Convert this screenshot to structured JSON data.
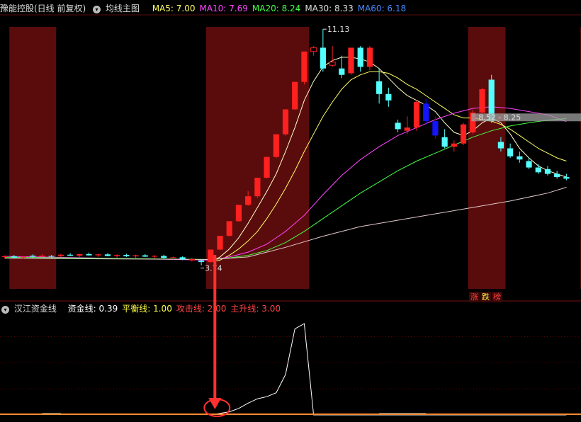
{
  "header": {
    "stock_title": "豫能控股(日线 前复权)",
    "indicator_name": "均线主图",
    "ma_labels": [
      {
        "text": "MA5: 7.00",
        "color": "#ffff66"
      },
      {
        "text": "MA10: 7.69",
        "color": "#ff44ff"
      },
      {
        "text": "MA20: 8.24",
        "color": "#44ff44"
      },
      {
        "text": "MA30: 8.33",
        "color": "#dddddd"
      },
      {
        "text": "MA60: 6.18",
        "color": "#4488ff"
      }
    ]
  },
  "sub_header": {
    "name": "汉江资金线",
    "labels": [
      {
        "text": "资金线: 0.39",
        "color": "#ffffff"
      },
      {
        "text": "平衡线: 1.00",
        "color": "#ffff44"
      },
      {
        "text": "攻击线: 2.00",
        "color": "#ff4444"
      },
      {
        "text": "主升线: 3.00",
        "color": "#ff4444"
      }
    ]
  },
  "colors": {
    "background": "#000000",
    "zone": "#5a0c0c",
    "up": "#ff2020",
    "down_cyan": "#54ffff",
    "down_blue": "#1414ff",
    "grid": "#5a0000",
    "arrow": "#ff3030"
  },
  "chart_data": [
    {
      "type": "candlestick",
      "ylim": [
        3.0,
        11.6
      ],
      "price_annotations": [
        {
          "text": "11.13",
          "value": 11.13
        },
        {
          "text": "3.74",
          "value": 3.74
        },
        {
          "text": "8.52 - 8.25",
          "value": 8.38
        }
      ],
      "highlight_zones": [
        [
          1,
          5
        ],
        [
          22,
          32
        ],
        [
          50,
          53
        ],
        [
          62,
          63
        ]
      ],
      "candles": [
        [
          4.0,
          4.05,
          3.95,
          4.02
        ],
        [
          4.02,
          4.06,
          3.96,
          3.98
        ],
        [
          3.98,
          4.03,
          3.94,
          4.01
        ],
        [
          4.01,
          4.08,
          3.97,
          4.04
        ],
        [
          4.04,
          4.09,
          4.0,
          4.01
        ],
        [
          4.01,
          4.06,
          3.96,
          4.03
        ],
        [
          4.03,
          4.1,
          3.99,
          4.07
        ],
        [
          4.07,
          4.12,
          4.02,
          4.04
        ],
        [
          4.04,
          4.1,
          4.0,
          4.09
        ],
        [
          4.09,
          4.14,
          4.04,
          4.05
        ],
        [
          4.05,
          4.1,
          4.0,
          4.08
        ],
        [
          4.08,
          4.12,
          4.02,
          4.03
        ],
        [
          4.03,
          4.08,
          3.98,
          4.06
        ],
        [
          4.06,
          4.1,
          4.0,
          4.02
        ],
        [
          4.02,
          4.07,
          3.97,
          4.05
        ],
        [
          4.05,
          4.09,
          4.0,
          4.01
        ],
        [
          4.01,
          4.06,
          3.96,
          4.03
        ],
        [
          4.03,
          4.07,
          3.95,
          3.97
        ],
        [
          3.97,
          4.01,
          3.92,
          3.99
        ],
        [
          3.99,
          4.02,
          3.9,
          3.93
        ],
        [
          3.93,
          3.97,
          3.86,
          3.89
        ],
        [
          3.89,
          3.92,
          3.74,
          3.84
        ],
        [
          3.84,
          4.23,
          3.82,
          4.23
        ],
        [
          4.23,
          4.66,
          4.22,
          4.66
        ],
        [
          4.66,
          5.12,
          4.64,
          5.12
        ],
        [
          5.12,
          5.63,
          5.1,
          5.63
        ],
        [
          5.63,
          6.06,
          5.6,
          5.9
        ],
        [
          5.9,
          6.48,
          5.85,
          6.48
        ],
        [
          6.48,
          7.13,
          6.46,
          7.13
        ],
        [
          7.13,
          7.84,
          7.1,
          7.84
        ],
        [
          7.84,
          8.62,
          7.8,
          8.62
        ],
        [
          8.62,
          9.48,
          8.6,
          9.48
        ],
        [
          9.48,
          10.43,
          9.4,
          10.43
        ],
        [
          10.43,
          10.6,
          10.3,
          10.55
        ],
        [
          10.55,
          11.13,
          9.8,
          9.9
        ],
        [
          10.0,
          10.6,
          9.95,
          10.1
        ],
        [
          9.9,
          10.3,
          9.6,
          9.7
        ],
        [
          9.75,
          10.55,
          9.7,
          10.55
        ],
        [
          10.55,
          10.6,
          9.8,
          9.95
        ],
        [
          9.95,
          10.6,
          9.85,
          10.55
        ],
        [
          9.5,
          9.9,
          8.8,
          9.1
        ],
        [
          9.1,
          9.3,
          8.7,
          8.9
        ],
        [
          8.2,
          8.3,
          7.9,
          8.0
        ],
        [
          7.95,
          8.4,
          7.85,
          8.05
        ],
        [
          8.05,
          8.9,
          7.95,
          8.85
        ],
        [
          8.8,
          8.95,
          8.15,
          8.25
        ],
        [
          8.25,
          8.4,
          7.7,
          7.8
        ],
        [
          7.75,
          8.0,
          7.4,
          7.45
        ],
        [
          7.45,
          7.65,
          7.3,
          7.55
        ],
        [
          7.55,
          8.2,
          7.5,
          8.15
        ],
        [
          7.9,
          8.6,
          7.85,
          8.52
        ],
        [
          8.52,
          9.3,
          8.5,
          9.25
        ],
        [
          9.55,
          9.7,
          8.2,
          8.25
        ],
        [
          7.6,
          7.75,
          7.3,
          7.4
        ],
        [
          7.4,
          7.55,
          7.1,
          7.15
        ],
        [
          7.15,
          7.3,
          6.95,
          7.05
        ],
        [
          7.0,
          7.1,
          6.75,
          6.8
        ],
        [
          6.8,
          6.9,
          6.6,
          6.65
        ],
        [
          6.75,
          6.85,
          6.55,
          6.6
        ],
        [
          6.6,
          6.7,
          6.45,
          6.5
        ],
        [
          6.5,
          6.6,
          6.4,
          6.45
        ]
      ],
      "moving_averages": [
        {
          "name": "MA5",
          "color": "#ffffcc",
          "points": [
            [
              22,
              3.85
            ],
            [
              23,
              4.0
            ],
            [
              24,
              4.25
            ],
            [
              25,
              4.6
            ],
            [
              26,
              5.05
            ],
            [
              27,
              5.55
            ],
            [
              28,
              6.05
            ],
            [
              29,
              6.6
            ],
            [
              30,
              7.3
            ],
            [
              31,
              8.05
            ],
            [
              32,
              8.9
            ],
            [
              33,
              9.5
            ],
            [
              34,
              9.95
            ],
            [
              35,
              10.15
            ],
            [
              36,
              10.25
            ],
            [
              37,
              10.25
            ],
            [
              38,
              10.2
            ],
            [
              39,
              10.1
            ],
            [
              40,
              9.9
            ],
            [
              41,
              9.6
            ],
            [
              42,
              9.3
            ],
            [
              43,
              9.05
            ],
            [
              44,
              8.9
            ],
            [
              45,
              8.75
            ],
            [
              46,
              8.55
            ],
            [
              47,
              8.2
            ],
            [
              48,
              7.9
            ],
            [
              49,
              7.8
            ],
            [
              50,
              7.95
            ],
            [
              51,
              8.2
            ],
            [
              52,
              8.35
            ],
            [
              53,
              8.2
            ],
            [
              54,
              7.85
            ],
            [
              55,
              7.4
            ],
            [
              56,
              7.1
            ],
            [
              57,
              6.85
            ],
            [
              58,
              6.7
            ],
            [
              59,
              6.6
            ],
            [
              60,
              6.5
            ]
          ]
        },
        {
          "name": "MA10",
          "color": "#ffff66",
          "points": [
            [
              22,
              3.85
            ],
            [
              23,
              3.9
            ],
            [
              24,
              4.05
            ],
            [
              25,
              4.25
            ],
            [
              26,
              4.5
            ],
            [
              27,
              4.8
            ],
            [
              28,
              5.2
            ],
            [
              29,
              5.65
            ],
            [
              30,
              6.15
            ],
            [
              31,
              6.7
            ],
            [
              32,
              7.3
            ],
            [
              33,
              7.85
            ],
            [
              34,
              8.4
            ],
            [
              35,
              8.85
            ],
            [
              36,
              9.25
            ],
            [
              37,
              9.55
            ],
            [
              38,
              9.7
            ],
            [
              39,
              9.8
            ],
            [
              40,
              9.8
            ],
            [
              41,
              9.75
            ],
            [
              42,
              9.6
            ],
            [
              43,
              9.4
            ],
            [
              44,
              9.25
            ],
            [
              45,
              9.05
            ],
            [
              46,
              8.85
            ],
            [
              47,
              8.65
            ],
            [
              48,
              8.45
            ],
            [
              49,
              8.35
            ],
            [
              50,
              8.35
            ],
            [
              51,
              8.3
            ],
            [
              52,
              8.25
            ],
            [
              53,
              8.15
            ],
            [
              54,
              8.0
            ],
            [
              55,
              7.8
            ],
            [
              56,
              7.6
            ],
            [
              57,
              7.4
            ],
            [
              58,
              7.25
            ],
            [
              59,
              7.1
            ],
            [
              60,
              7.0
            ]
          ]
        },
        {
          "name": "MA20",
          "color": "#ff44ff",
          "points": [
            [
              0,
              4.02
            ],
            [
              22,
              3.9
            ],
            [
              24,
              4.0
            ],
            [
              26,
              4.15
            ],
            [
              28,
              4.4
            ],
            [
              30,
              4.8
            ],
            [
              32,
              5.3
            ],
            [
              34,
              5.95
            ],
            [
              36,
              6.55
            ],
            [
              38,
              7.05
            ],
            [
              40,
              7.45
            ],
            [
              42,
              7.8
            ],
            [
              44,
              8.05
            ],
            [
              46,
              8.3
            ],
            [
              48,
              8.5
            ],
            [
              50,
              8.65
            ],
            [
              52,
              8.7
            ],
            [
              54,
              8.65
            ],
            [
              56,
              8.55
            ],
            [
              58,
              8.45
            ],
            [
              60,
              8.24
            ]
          ]
        },
        {
          "name": "MA30",
          "color": "#44ff44",
          "points": [
            [
              0,
              3.99
            ],
            [
              22,
              3.92
            ],
            [
              24,
              3.97
            ],
            [
              26,
              4.05
            ],
            [
              28,
              4.2
            ],
            [
              30,
              4.45
            ],
            [
              32,
              4.8
            ],
            [
              34,
              5.2
            ],
            [
              36,
              5.6
            ],
            [
              38,
              6.0
            ],
            [
              40,
              6.35
            ],
            [
              42,
              6.7
            ],
            [
              44,
              7.0
            ],
            [
              46,
              7.25
            ],
            [
              48,
              7.5
            ],
            [
              50,
              7.75
            ],
            [
              52,
              7.95
            ],
            [
              54,
              8.1
            ],
            [
              56,
              8.2
            ],
            [
              58,
              8.28
            ],
            [
              60,
              8.33
            ]
          ]
        },
        {
          "name": "MA60",
          "color": "#e0c8c8",
          "points": [
            [
              0,
              3.96
            ],
            [
              22,
              3.92
            ],
            [
              26,
              4.0
            ],
            [
              30,
              4.3
            ],
            [
              34,
              4.65
            ],
            [
              38,
              4.95
            ],
            [
              42,
              5.15
            ],
            [
              46,
              5.35
            ],
            [
              50,
              5.55
            ],
            [
              54,
              5.75
            ],
            [
              58,
              6.0
            ],
            [
              60,
              6.18
            ]
          ]
        }
      ]
    },
    {
      "type": "line",
      "series": [
        {
          "name": "资金线",
          "color": "#ffffff",
          "points": [
            [
              22,
              0.0
            ],
            [
              23,
              0.06
            ],
            [
              24,
              0.12
            ],
            [
              25,
              0.25
            ],
            [
              26,
              0.45
            ],
            [
              27,
              0.62
            ],
            [
              28,
              0.7
            ],
            [
              29,
              0.85
            ],
            [
              30,
              1.55
            ],
            [
              31,
              3.3
            ],
            [
              32,
              3.5
            ],
            [
              33,
              0.0
            ],
            [
              60,
              0.0
            ]
          ]
        }
      ],
      "reference_lines": [
        {
          "name": "平衡线",
          "value": 1.0
        },
        {
          "name": "攻击线",
          "value": 2.0
        },
        {
          "name": "主升线",
          "value": 3.0
        }
      ]
    }
  ],
  "tags": [
    {
      "text": "涨",
      "color": "#ff4040"
    },
    {
      "text": "跌",
      "color": "#ffff44"
    },
    {
      "text": "榜",
      "color": "#ff4040"
    }
  ]
}
